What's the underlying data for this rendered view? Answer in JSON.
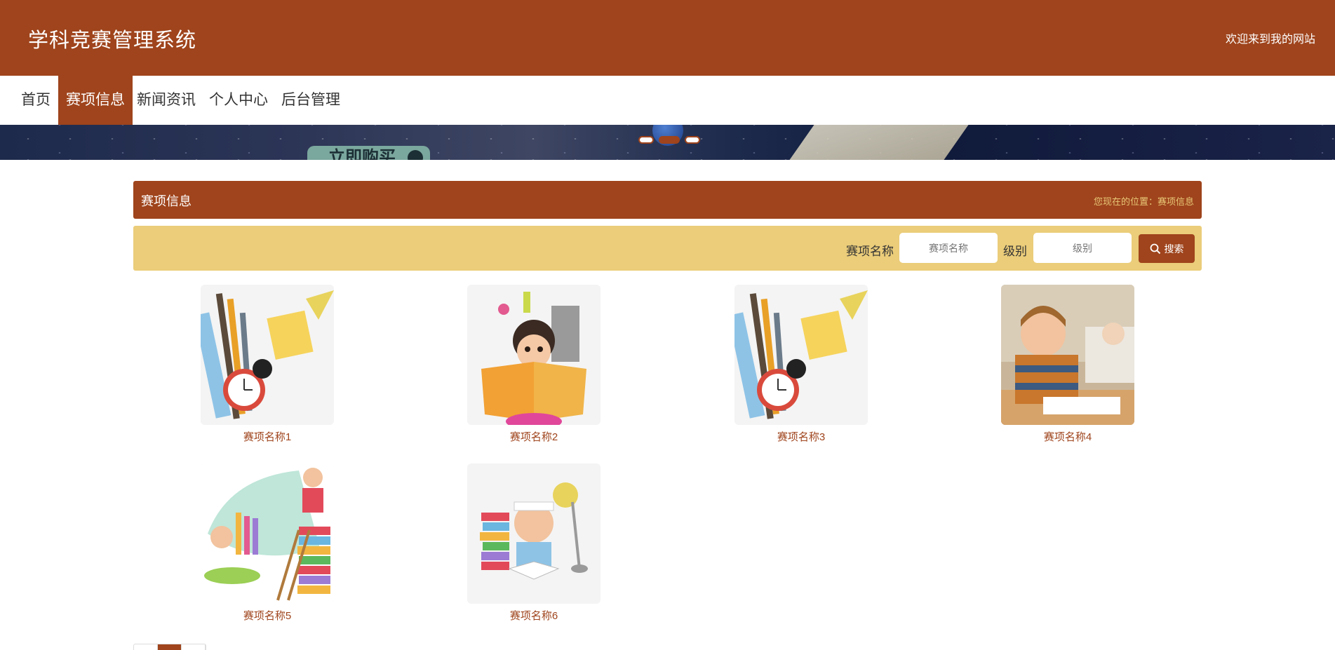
{
  "header": {
    "site_title": "学科竞赛管理系统",
    "welcome": "欢迎来到我的网站"
  },
  "nav": {
    "items": [
      {
        "label": "首页",
        "active": false
      },
      {
        "label": "赛项信息",
        "active": true
      },
      {
        "label": "新闻资讯",
        "active": false
      },
      {
        "label": "个人中心",
        "active": false
      },
      {
        "label": "后台管理",
        "active": false
      }
    ]
  },
  "banner": {
    "button_text": "立即购买",
    "carousel_active_index": 1,
    "carousel_count": 3
  },
  "section": {
    "title": "赛项信息",
    "location": "您现在的位置：赛项信息"
  },
  "search": {
    "name_label": "赛项名称",
    "name_placeholder": "赛项名称",
    "level_label": "级别",
    "level_placeholder": "级别",
    "button_label": "搜索"
  },
  "items": [
    {
      "name": "赛项名称1",
      "image": "stationery-clock-illustration"
    },
    {
      "name": "赛项名称2",
      "image": "girl-reading-book-illustration"
    },
    {
      "name": "赛项名称3",
      "image": "stationery-clock-illustration"
    },
    {
      "name": "赛项名称4",
      "image": "boy-in-classroom-photo"
    },
    {
      "name": "赛项名称5",
      "image": "kids-books-ladder-illustration"
    },
    {
      "name": "赛项名称6",
      "image": "boy-studying-lamp-illustration"
    }
  ],
  "colors": {
    "primary": "#9f441c",
    "search_bar": "#ebcd7a",
    "location_text": "#e8c777"
  }
}
